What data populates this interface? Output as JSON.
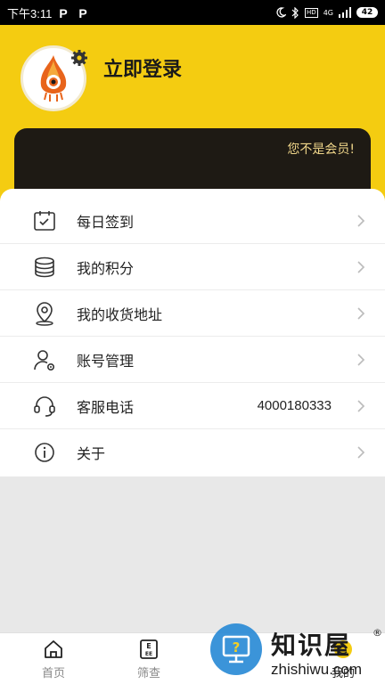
{
  "status_bar": {
    "time": "下午3:11",
    "app_glyph": "P",
    "network": "4G",
    "hd": "HD",
    "battery": "42"
  },
  "header": {
    "login_label": "立即登录",
    "member_text": "您不是会员!",
    "brand_color": "#f4cc11",
    "card_color": "#1e1a14"
  },
  "menu": {
    "items": [
      {
        "label": "每日签到",
        "icon": "calendar-check-icon",
        "value": ""
      },
      {
        "label": "我的积分",
        "icon": "coin-stack-icon",
        "value": ""
      },
      {
        "label": "我的收货地址",
        "icon": "location-pin-icon",
        "value": ""
      },
      {
        "label": "账号管理",
        "icon": "user-gear-icon",
        "value": ""
      },
      {
        "label": "客服电话",
        "icon": "headset-icon",
        "value": "4000180333"
      },
      {
        "label": "关于",
        "icon": "info-icon",
        "value": ""
      }
    ]
  },
  "tabbar": {
    "tabs": [
      {
        "label": "首页",
        "icon": "home-icon"
      },
      {
        "label": "筛查",
        "icon": "eye-chart-icon"
      },
      {
        "label": "我的",
        "icon": "profile-icon"
      }
    ]
  },
  "watermark": {
    "title": "知识屋",
    "url": "zhishiwu.com",
    "reg": "®",
    "mark": "?"
  }
}
